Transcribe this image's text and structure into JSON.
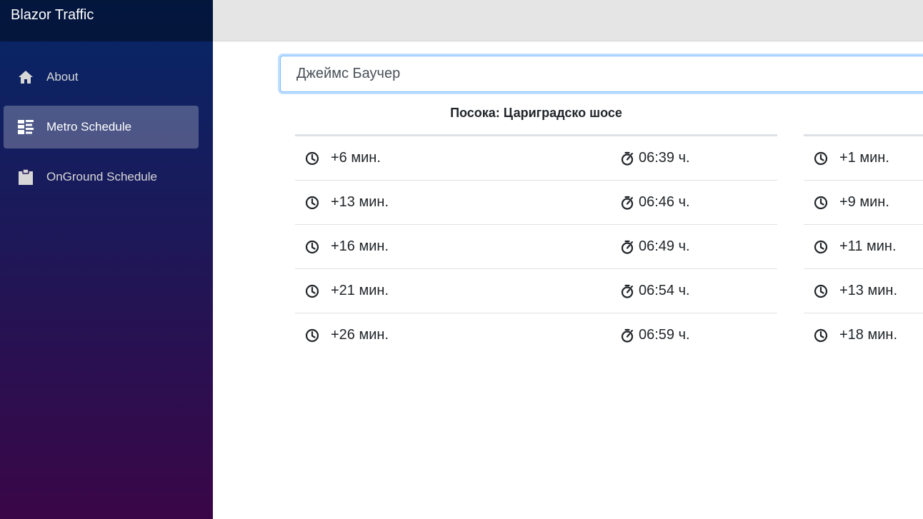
{
  "app": {
    "brand": "Blazor Traffic"
  },
  "nav": {
    "items": [
      {
        "label": "About",
        "icon": "home-icon",
        "active": false
      },
      {
        "label": "Metro Schedule",
        "icon": "dashboard-icon",
        "active": true
      },
      {
        "label": "OnGround Schedule",
        "icon": "clipboard-icon",
        "active": false
      }
    ]
  },
  "search": {
    "value": "Джеймс Баучер"
  },
  "station": {
    "title": "Посока: Цариградско шосе"
  },
  "schedule_left": [
    {
      "wait": "+6 мин.",
      "time": "06:39 ч."
    },
    {
      "wait": "+13 мин.",
      "time": "06:46 ч."
    },
    {
      "wait": "+16 мин.",
      "time": "06:49 ч."
    },
    {
      "wait": "+21 мин.",
      "time": "06:54 ч."
    },
    {
      "wait": "+26 мин.",
      "time": "06:59 ч."
    }
  ],
  "schedule_right": [
    {
      "wait": "+1 мин."
    },
    {
      "wait": "+9 мин."
    },
    {
      "wait": "+11 мин."
    },
    {
      "wait": "+13 мин."
    },
    {
      "wait": "+18 мин."
    }
  ],
  "colors": {
    "sidebar_top": "#052767",
    "sidebar_bottom": "#3a0647",
    "focus_border": "#80bdff"
  }
}
